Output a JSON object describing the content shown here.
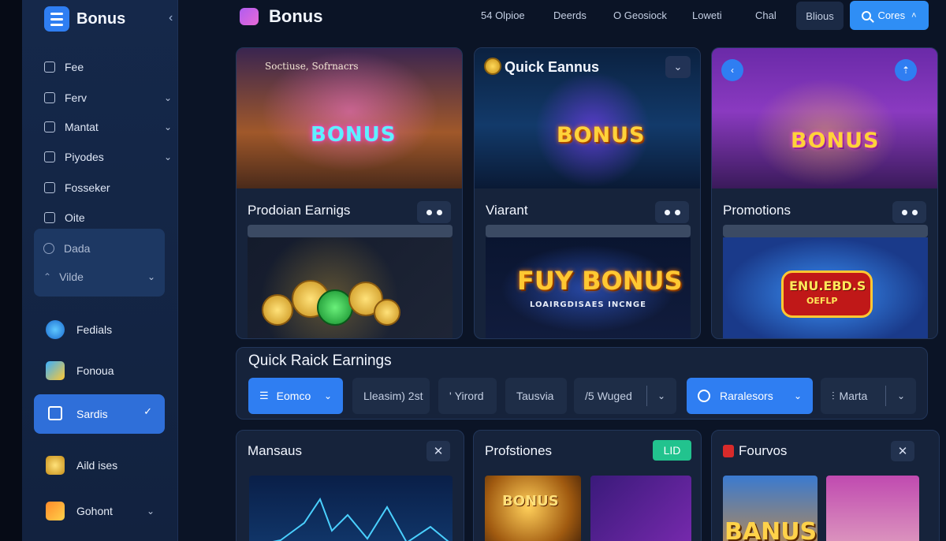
{
  "sidebar": {
    "brand": "Bonus",
    "items": [
      {
        "label": "Fee",
        "has_chevron": false
      },
      {
        "label": "Ferv",
        "has_chevron": true
      },
      {
        "label": "Mantat",
        "has_chevron": true
      },
      {
        "label": "Piyodes",
        "has_chevron": true
      },
      {
        "label": "Fosseker",
        "has_chevron": false
      },
      {
        "label": "Oite",
        "has_chevron": false
      }
    ],
    "group": [
      {
        "label": "Dada"
      },
      {
        "label": "Vilde"
      }
    ],
    "big_items": [
      {
        "label": "Fedials"
      },
      {
        "label": "Fonoua"
      },
      {
        "label": "Sardis",
        "active": true
      },
      {
        "label": "Aild ises"
      },
      {
        "label": "Gohont"
      }
    ]
  },
  "topbar": {
    "title": "Bonus",
    "links": [
      "54 Olpioe",
      "Deerds",
      "O Geosiock",
      "Loweti",
      "Chal"
    ],
    "pill": "Blious",
    "button": "Cores"
  },
  "cards": [
    {
      "hero_caption": "Soctiuse, Sofrnacrs",
      "hero_label": "BONUS",
      "title": "Prodoian Earnigs",
      "media_title": "",
      "media_sub": ""
    },
    {
      "hero_caption": "Quick Eannus",
      "hero_label": "BONUS",
      "title": "Viarant",
      "media_title": "FUY BONUS",
      "media_sub": "LOAIRGDISAES INCNGE"
    },
    {
      "hero_caption": "",
      "hero_label": "BONUS",
      "title": "Promotions",
      "media_title": "ENU.EBD.S",
      "media_sub": "OEFLP"
    }
  ],
  "quick": {
    "title": "Quick Raick Earnings",
    "buttons": [
      {
        "label": "Eomco",
        "primary": true,
        "chevron": true
      },
      {
        "label": "Lleasim) 2st",
        "primary": false,
        "chevron": false
      },
      {
        "label": "Yirord",
        "primary": false,
        "chevron": false
      },
      {
        "label": "Tausvia",
        "primary": false,
        "chevron": false
      },
      {
        "label": "Wuged",
        "primary": false,
        "chevron": true
      },
      {
        "label": "Raralesors",
        "primary": true,
        "chevron": true
      },
      {
        "label": "Marta",
        "primary": false,
        "chevron": true
      }
    ]
  },
  "bottom": [
    {
      "title": "Mansaus",
      "action": "close"
    },
    {
      "title": "Profstiones",
      "badge": "LID",
      "media_label": "BONUS"
    },
    {
      "title": "Fourvos",
      "action": "close",
      "media_label": "BANUS"
    }
  ],
  "colors": {
    "accent": "#2f7ef2",
    "background": "#0b1426",
    "card": "#16233b",
    "badge_green": "#22c38e"
  }
}
